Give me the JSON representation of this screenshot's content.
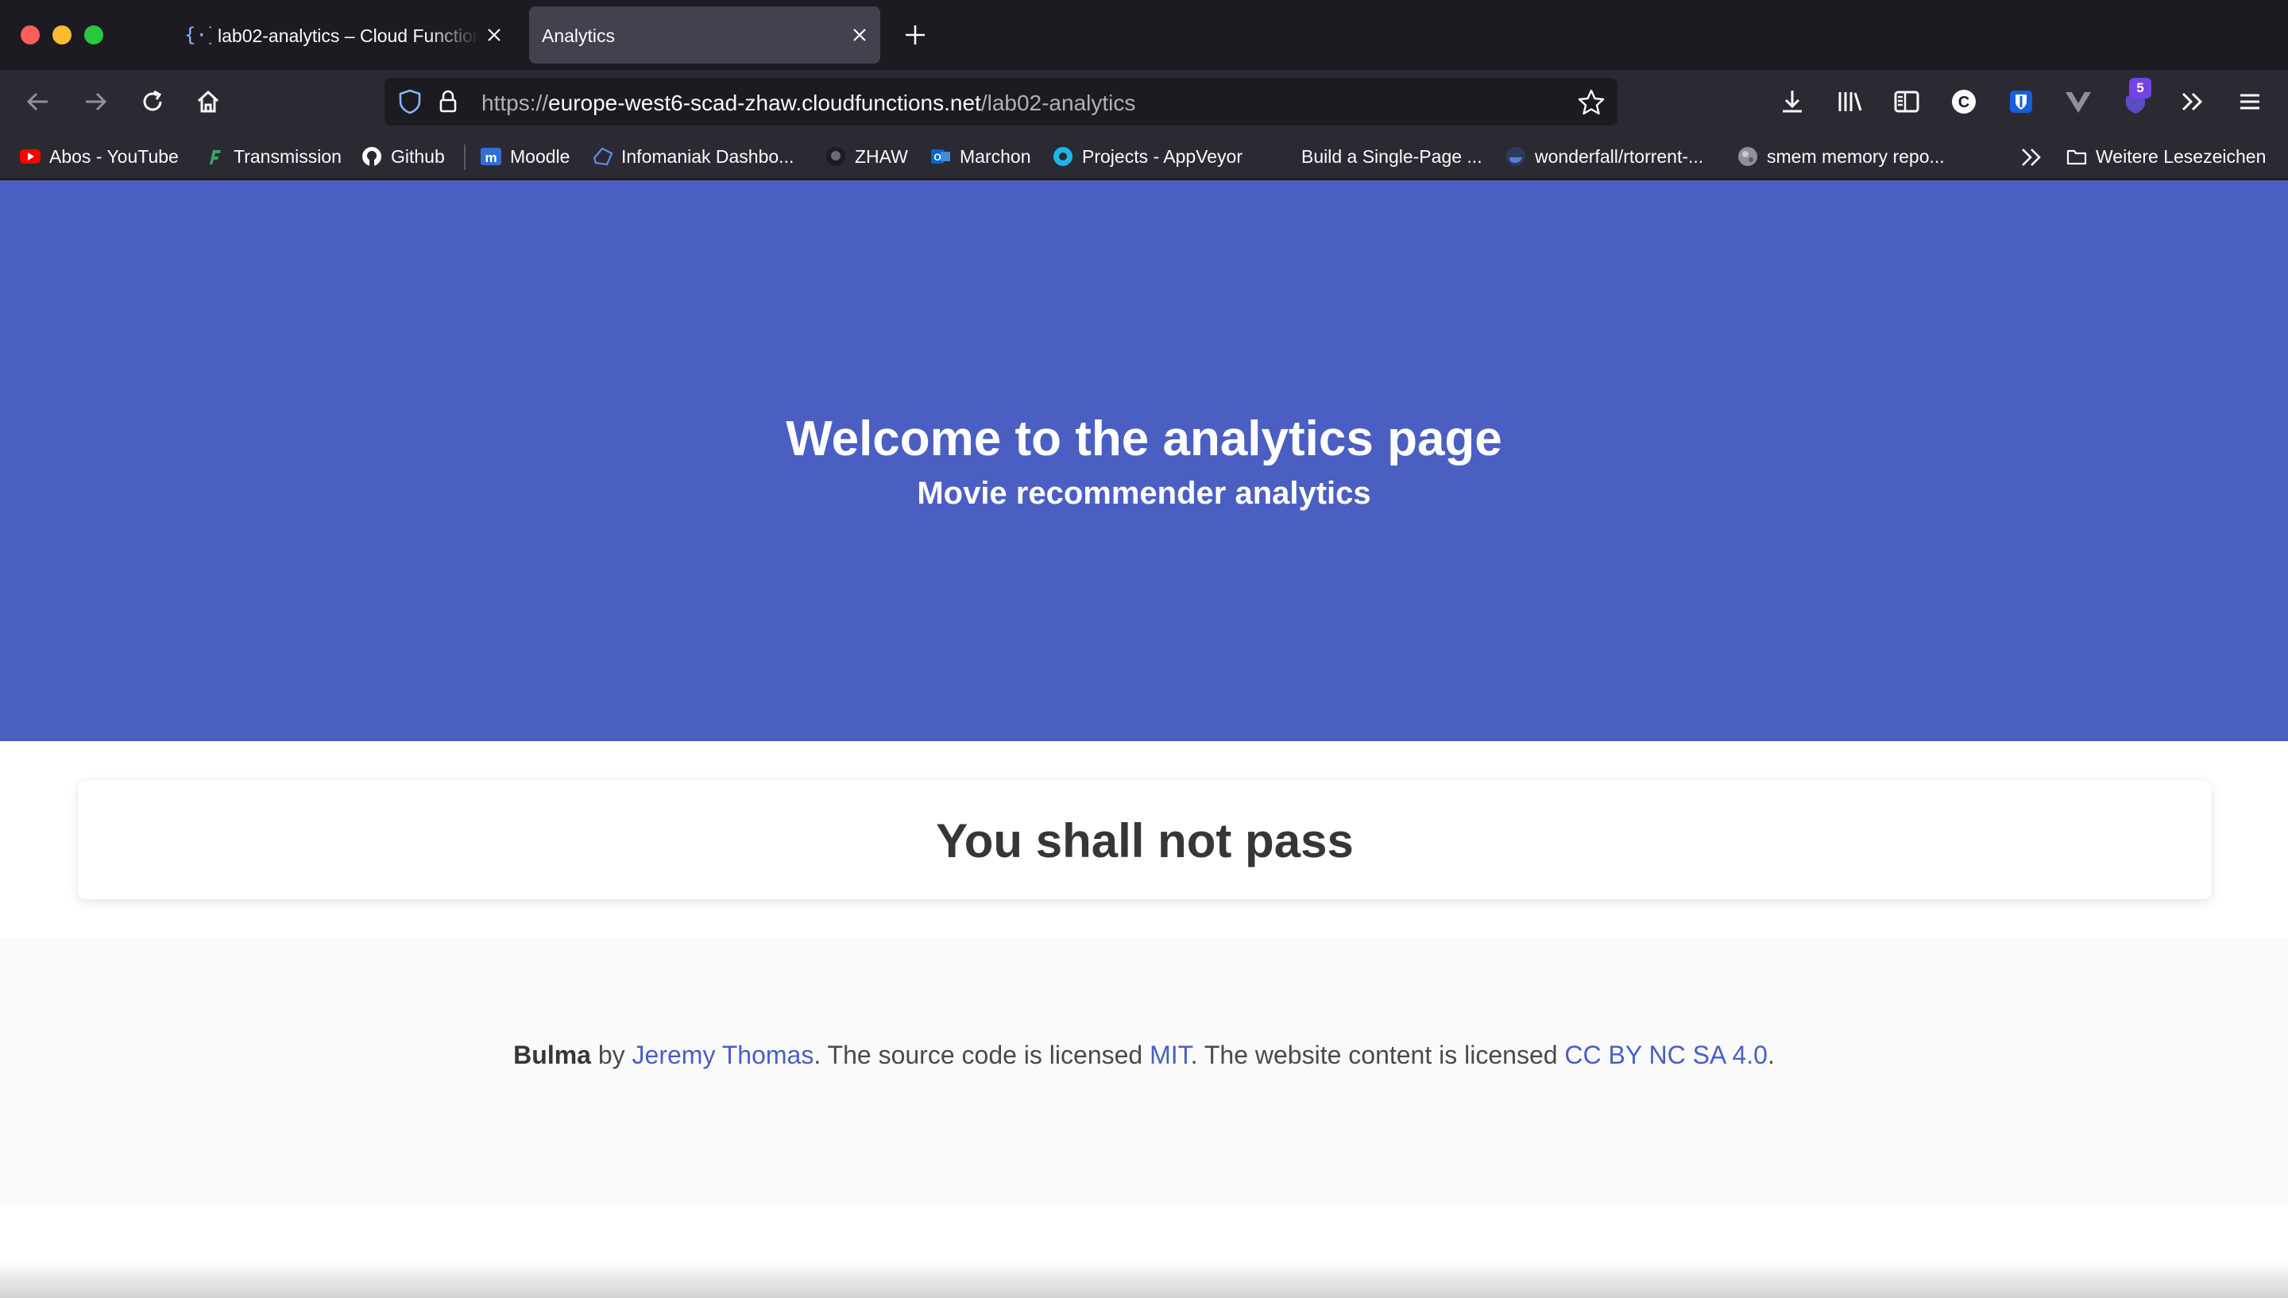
{
  "colors": {
    "hero_bg": "#4b5ec2",
    "link": "#485fc7",
    "chrome_bg": "#2b2a33",
    "tabbar_bg": "#1c1b22"
  },
  "tabs": [
    {
      "title": "lab02-analytics – Cloud Functions",
      "icon": "cloud-functions-icon"
    },
    {
      "title": "Analytics",
      "icon": ""
    }
  ],
  "address_bar": {
    "scheme": "https://",
    "host": "europe-west6-scad-zhaw.cloudfunctions.net",
    "path": "/lab02-analytics"
  },
  "extensions_badge": "5",
  "bookmarks": [
    {
      "label": "Abos - YouTube",
      "icon": "youtube-icon"
    },
    {
      "label": "Transmission",
      "icon": "transmission-icon"
    },
    {
      "label": "Github",
      "icon": "github-icon"
    },
    {
      "label": "Moodle",
      "icon": "moodle-icon"
    },
    {
      "label": "Infomaniak Dashbo...",
      "icon": "infomaniak-icon"
    },
    {
      "label": "ZHAW",
      "icon": "github-icon"
    },
    {
      "label": "Marchon",
      "icon": "outlook-icon"
    },
    {
      "label": "Projects - AppVeyor",
      "icon": "appveyor-icon"
    },
    {
      "label": "Build a Single-Page ...",
      "icon": ""
    },
    {
      "label": "wonderfall/rtorrent-...",
      "icon": "docker-icon"
    },
    {
      "label": "smem memory repo...",
      "icon": "globe-icon"
    }
  ],
  "other_bookmarks": "Weitere Lesezeichen",
  "hero": {
    "title": "Welcome to the analytics page",
    "subtitle": "Movie recommender analytics"
  },
  "card": {
    "title": "You shall not pass"
  },
  "footer": {
    "brand": "Bulma",
    "by": " by ",
    "author": "Jeremy Thomas",
    "source_text": ". The source code is licensed ",
    "source_license": "MIT",
    "content_text": ". The website content is licensed ",
    "content_license": "CC BY NC SA 4.0",
    "end": "."
  }
}
